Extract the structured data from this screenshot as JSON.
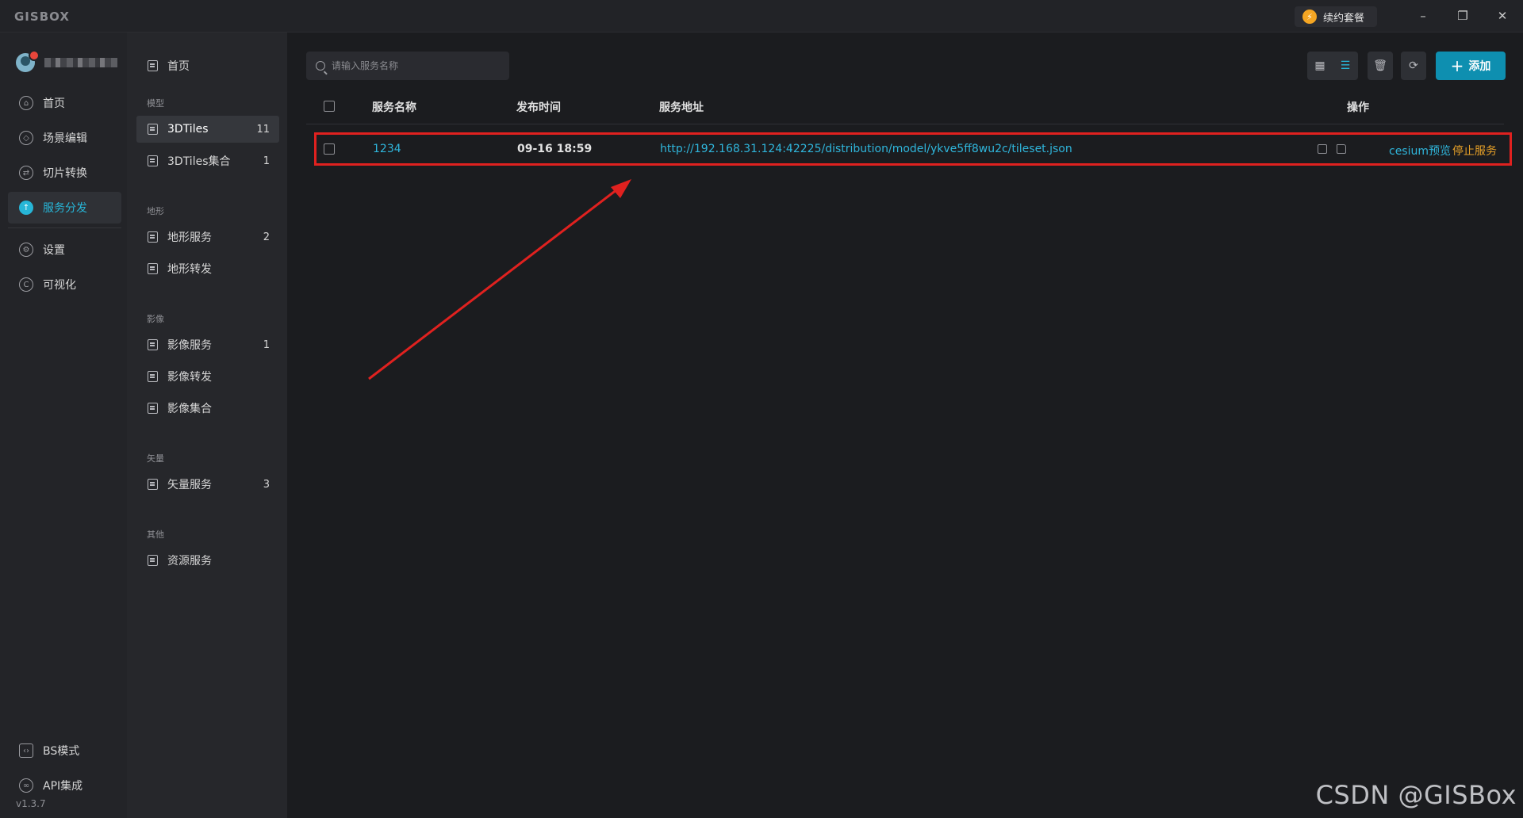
{
  "app": {
    "logo": "GISBOX",
    "renew_label": "续约套餐",
    "window_controls": [
      "minimize-icon",
      "restore-icon",
      "close-icon"
    ]
  },
  "nav": {
    "items": [
      {
        "label": "首页",
        "icon": "home-icon"
      },
      {
        "label": "场景编辑",
        "icon": "cube-icon"
      },
      {
        "label": "切片转换",
        "icon": "convert-icon"
      },
      {
        "label": "服务分发",
        "icon": "upload-icon",
        "active": true
      },
      {
        "label": "设置",
        "icon": "gear-icon"
      },
      {
        "label": "可视化",
        "icon": "visual-icon"
      }
    ],
    "bottom": [
      {
        "label": "BS模式",
        "icon": "code-icon"
      },
      {
        "label": "API集成",
        "icon": "link-icon"
      }
    ],
    "version": "v1.3.7"
  },
  "categories": {
    "home": "首页",
    "groups": [
      {
        "title": "模型",
        "items": [
          {
            "label": "3DTiles",
            "count": "11",
            "active": true
          },
          {
            "label": "3DTiles集合",
            "count": "1"
          }
        ]
      },
      {
        "title": "地形",
        "items": [
          {
            "label": "地形服务",
            "count": "2"
          },
          {
            "label": "地形转发",
            "count": ""
          }
        ]
      },
      {
        "title": "影像",
        "items": [
          {
            "label": "影像服务",
            "count": "1"
          },
          {
            "label": "影像转发",
            "count": ""
          },
          {
            "label": "影像集合",
            "count": ""
          }
        ]
      },
      {
        "title": "矢量",
        "items": [
          {
            "label": "矢量服务",
            "count": "3"
          }
        ]
      },
      {
        "title": "其他",
        "items": [
          {
            "label": "资源服务",
            "count": ""
          }
        ]
      }
    ]
  },
  "main": {
    "search_placeholder": "请输入服务名称",
    "add_label": "添加",
    "columns": {
      "name": "服务名称",
      "time": "发布时间",
      "url": "服务地址",
      "ops": "操作"
    },
    "rows": [
      {
        "name": "1234",
        "time": "09-16 18:59",
        "url": "http://192.168.31.124:42225/distribution/model/ykve5ff8wu2c/tileset.json",
        "preview": "cesium预览",
        "stop": "停止服务"
      }
    ]
  },
  "watermark": "CSDN @GISBox",
  "colors": {
    "accent": "#27b6d8",
    "add_button": "#0e8fb0",
    "stop_link": "#e6a028",
    "highlight_box": "#e0211f",
    "arrow": "#e0211f"
  }
}
